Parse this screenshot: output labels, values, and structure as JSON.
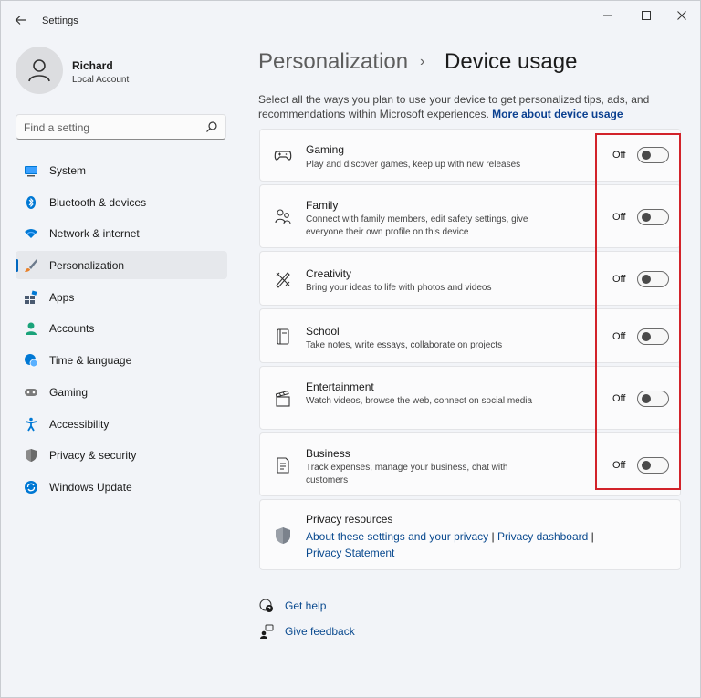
{
  "window": {
    "title": "Settings"
  },
  "profile": {
    "name": "Richard",
    "account_type": "Local Account"
  },
  "search": {
    "placeholder": "Find a setting"
  },
  "sidebar": {
    "items": [
      {
        "label": "System",
        "icon": "system-icon",
        "color": "#0078d4"
      },
      {
        "label": "Bluetooth & devices",
        "icon": "bluetooth-icon",
        "color": "#0078d4"
      },
      {
        "label": "Network & internet",
        "icon": "network-icon",
        "color": "#0078d4"
      },
      {
        "label": "Personalization",
        "icon": "brush-icon",
        "color": "#e8812a",
        "active": true
      },
      {
        "label": "Apps",
        "icon": "apps-icon",
        "color": "#4a5a70"
      },
      {
        "label": "Accounts",
        "icon": "accounts-icon",
        "color": "#1aa37a"
      },
      {
        "label": "Time & language",
        "icon": "globe-clock-icon",
        "color": "#0078d4"
      },
      {
        "label": "Gaming",
        "icon": "gamepad-icon",
        "color": "#6b6b6b"
      },
      {
        "label": "Accessibility",
        "icon": "accessibility-icon",
        "color": "#0078d4"
      },
      {
        "label": "Privacy & security",
        "icon": "shield-icon",
        "color": "#6b6b6b"
      },
      {
        "label": "Windows Update",
        "icon": "update-icon",
        "color": "#0078d4"
      }
    ]
  },
  "breadcrumb": {
    "parent": "Personalization",
    "separator": "›",
    "current": "Device usage"
  },
  "description": {
    "text": "Select all the ways you plan to use your device to get personalized tips, ads, and recommendations within Microsoft experiences.",
    "link": "More about device usage"
  },
  "usages": [
    {
      "title": "Gaming",
      "subtitle": "Play and discover games, keep up with new releases",
      "state": "Off",
      "icon": "controller-icon"
    },
    {
      "title": "Family",
      "subtitle": "Connect with family members, edit safety settings, give everyone their own profile on this device",
      "state": "Off",
      "icon": "family-icon"
    },
    {
      "title": "Creativity",
      "subtitle": "Bring your ideas to life with photos and videos",
      "state": "Off",
      "icon": "pen-ruler-icon"
    },
    {
      "title": "School",
      "subtitle": "Take notes, write essays, collaborate on projects",
      "state": "Off",
      "icon": "notebook-icon"
    },
    {
      "title": "Entertainment",
      "subtitle": "Watch videos, browse the web, connect on social media",
      "state": "Off",
      "icon": "clapperboard-icon"
    },
    {
      "title": "Business",
      "subtitle": "Track expenses, manage your business, chat with customers",
      "state": "Off",
      "icon": "document-icon"
    }
  ],
  "privacy": {
    "title": "Privacy resources",
    "link1": "About these settings and your privacy",
    "link2": "Privacy dashboard",
    "link3": "Privacy Statement",
    "divider": "|"
  },
  "help": {
    "get_help": "Get help",
    "give_feedback": "Give feedback"
  },
  "colors": {
    "accent": "#0067c0",
    "highlight": "#d2232a"
  }
}
